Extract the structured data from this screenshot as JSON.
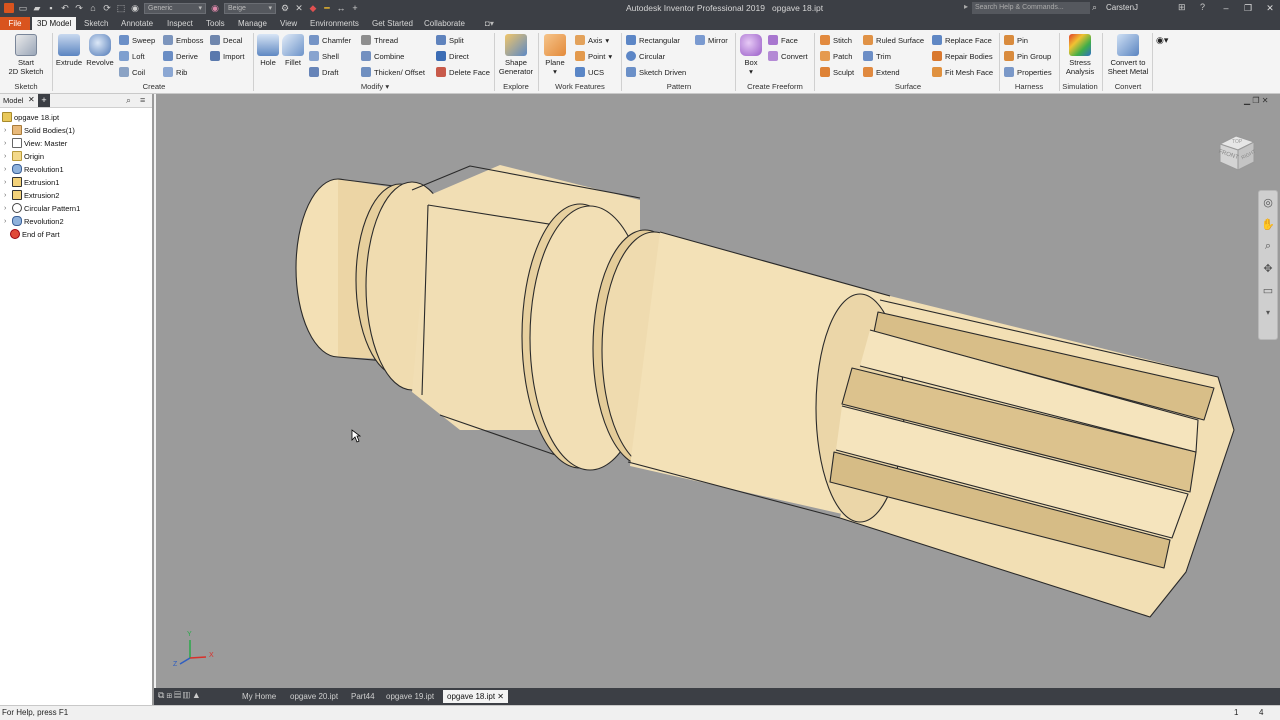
{
  "titlebar": {
    "app_title": "Autodesk Inventor Professional 2019",
    "doc_title": "opgave 18.ipt",
    "material_dropdown": "Generic",
    "appearance_dropdown": "Beige",
    "search_placeholder": "Search Help & Commands...",
    "user": "CarstenJ",
    "minimize": "–",
    "restore": "❐",
    "close": "✕"
  },
  "tabs": [
    "File",
    "3D Model",
    "Sketch",
    "Annotate",
    "Inspect",
    "Tools",
    "Manage",
    "View",
    "Environments",
    "Get Started",
    "Collaborate"
  ],
  "ribbon": {
    "sketch": {
      "start_sketch_l1": "Start",
      "start_sketch_l2": "2D Sketch",
      "group": "Sketch"
    },
    "create": {
      "extrude": "Extrude",
      "revolve": "Revolve",
      "sweep": "Sweep",
      "loft": "Loft",
      "coil": "Coil",
      "emboss": "Emboss",
      "derive": "Derive",
      "rib": "Rib",
      "decal": "Decal",
      "import": "Import",
      "group": "Create"
    },
    "modify": {
      "hole": "Hole",
      "fillet": "Fillet",
      "chamfer": "Chamfer",
      "shell": "Shell",
      "draft": "Draft",
      "thread": "Thread",
      "combine": "Combine",
      "thicken": "Thicken/ Offset",
      "split": "Split",
      "direct": "Direct",
      "delete_face": "Delete Face",
      "group": "Modify"
    },
    "explore": {
      "shape_gen_l1": "Shape",
      "shape_gen_l2": "Generator",
      "group": "Explore"
    },
    "work": {
      "plane": "Plane",
      "axis": "Axis",
      "point": "Point",
      "ucs": "UCS",
      "group": "Work Features"
    },
    "pattern": {
      "rectangular": "Rectangular",
      "circular": "Circular",
      "sketch_driven": "Sketch Driven",
      "mirror": "Mirror",
      "group": "Pattern"
    },
    "freeform": {
      "box": "Box",
      "face": "Face",
      "convert": "Convert",
      "group": "Create Freeform"
    },
    "surface": {
      "stitch": "Stitch",
      "patch": "Patch",
      "sculpt": "Sculpt",
      "ruled": "Ruled Surface",
      "trim": "Trim",
      "extend": "Extend",
      "replace_face": "Replace Face",
      "repair_bodies": "Repair Bodies",
      "fit_mesh": "Fit Mesh Face",
      "group": "Surface"
    },
    "harness": {
      "pin": "Pin",
      "pin_group": "Pin Group",
      "properties": "Properties",
      "group": "Harness"
    },
    "simulation": {
      "stress_l1": "Stress",
      "stress_l2": "Analysis",
      "group": "Simulation"
    },
    "convert": {
      "sheet_l1": "Convert to",
      "sheet_l2": "Sheet Metal",
      "group": "Convert"
    }
  },
  "browser": {
    "tab": "Model",
    "add": "+",
    "tree": [
      {
        "label": "opgave 18.ipt"
      },
      {
        "label": "Solid Bodies(1)"
      },
      {
        "label": "View: Master"
      },
      {
        "label": "Origin"
      },
      {
        "label": "Revolution1"
      },
      {
        "label": "Extrusion1"
      },
      {
        "label": "Extrusion2"
      },
      {
        "label": "Circular Pattern1"
      },
      {
        "label": "Revolution2"
      },
      {
        "label": "End of Part"
      }
    ]
  },
  "viewcube": {
    "front": "FRONT",
    "right": "RIGHT",
    "top": "TOP"
  },
  "triad": {
    "x": "X",
    "y": "Y",
    "z": "Z"
  },
  "doc_tabs": [
    "My Home",
    "opgave 20.ipt",
    "Part44",
    "opgave 19.ipt",
    "opgave 18.ipt"
  ],
  "status": {
    "help": "For Help, press F1",
    "num1": "1",
    "num2": "4"
  },
  "colors": {
    "accent": "#d9541e",
    "part": "#f1dcb0",
    "viewport": "#9b9b9b",
    "chrome": "#3c3f45"
  }
}
